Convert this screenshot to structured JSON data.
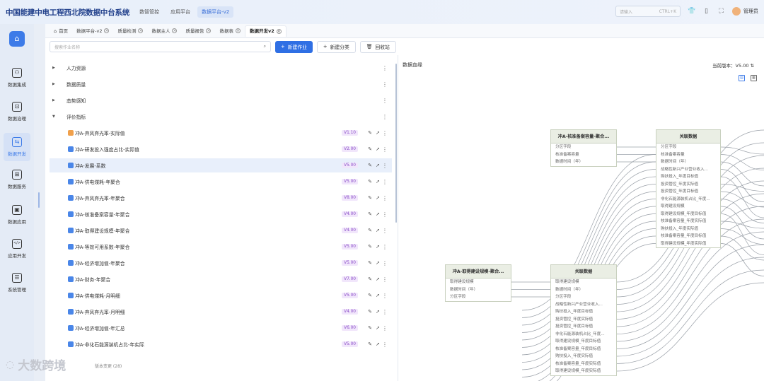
{
  "app": {
    "title": "中国能建中电工程西北院数据中台系统",
    "topnav": [
      {
        "label": "数智管控",
        "active": false
      },
      {
        "label": "应用平台",
        "active": false
      },
      {
        "label": "数据平台-v2",
        "active": true
      }
    ],
    "search_placeholder": "请输入",
    "search_shortcut": "CTRL+K",
    "user": "管理员"
  },
  "sidebar": {
    "items": [
      {
        "label": "数据集成",
        "icon": "integration-icon",
        "glyph": "⚇"
      },
      {
        "label": "数据治理",
        "icon": "folder-governance-icon",
        "glyph": "⊡"
      },
      {
        "label": "数据开发",
        "icon": "flow-develop-icon",
        "glyph": "⇆"
      },
      {
        "label": "数据服务",
        "icon": "grid-service-icon",
        "glyph": "⊞"
      },
      {
        "label": "数据应用",
        "icon": "app-icon",
        "glyph": "▣"
      },
      {
        "label": "应用开发",
        "icon": "code-icon",
        "glyph": "</>"
      },
      {
        "label": "系统管理",
        "icon": "settings-icon",
        "glyph": "☰"
      }
    ],
    "active": "数据开发"
  },
  "tabs": [
    {
      "label": "首页",
      "closable": false,
      "active": false
    },
    {
      "label": "数据平台-v2",
      "closable": true,
      "active": false
    },
    {
      "label": "质量检测",
      "closable": true,
      "active": false
    },
    {
      "label": "数据主人",
      "closable": true,
      "active": false
    },
    {
      "label": "质量报告",
      "closable": true,
      "active": false
    },
    {
      "label": "数据表",
      "closable": true,
      "active": false
    },
    {
      "label": "数据开发v2",
      "closable": true,
      "active": true
    }
  ],
  "toolbar": {
    "search_placeholder": "搜索作业名称",
    "new_job": "新建作业",
    "new_category": "新建分类",
    "recycle": "回收站"
  },
  "tree": {
    "folders": [
      "人力资源",
      "数据质量",
      "态势感知",
      "评价指标"
    ],
    "jobs": [
      {
        "name": "冲A-弃风弃光率-实际值",
        "version": "V1.10",
        "color": "#f0a04b"
      },
      {
        "name": "冲A-研发投入强度占比-实际值",
        "version": "V2.00",
        "color": "#4a86e8"
      },
      {
        "name": "冲A-发展-系数",
        "version": "V5.00",
        "color": "#4a86e8"
      },
      {
        "name": "冲A-供电煤耗-年聚合",
        "version": "V5.00",
        "color": "#4a86e8"
      },
      {
        "name": "冲A-弃风弃光率-年聚合",
        "version": "V8.00",
        "color": "#4a86e8"
      },
      {
        "name": "冲A-核准备案容量-年聚合",
        "version": "V4.00",
        "color": "#4a86e8"
      },
      {
        "name": "冲A-取得建设规模-年聚合",
        "version": "V4.00",
        "color": "#4a86e8"
      },
      {
        "name": "冲A-等效可用系数-年聚合",
        "version": "V5.00",
        "color": "#4a86e8"
      },
      {
        "name": "冲A-经济增加值-年聚合",
        "version": "V5.00",
        "color": "#4a86e8"
      },
      {
        "name": "冲A-财务-年聚合",
        "version": "V7.00",
        "color": "#4a86e8"
      },
      {
        "name": "冲A-供电煤耗-月明细",
        "version": "V5.00",
        "color": "#4a86e8"
      },
      {
        "name": "冲A-弃风弃光率-月明细",
        "version": "V4.00",
        "color": "#4a86e8"
      },
      {
        "name": "冲A-经济增加值-年汇总",
        "version": "V6.00",
        "color": "#4a86e8"
      },
      {
        "name": "冲A-非化石能源装机占比-年实际",
        "version": "V5.00",
        "color": "#4a86e8"
      }
    ],
    "selected_index": 2,
    "footer": "版本变更 (28)"
  },
  "lineage": {
    "title": "数据血缘",
    "current_version_label": "当前版本：V5.00",
    "nodes": [
      {
        "title": "冲A-核准备案容量-聚合...",
        "fields": [
          "分区字段",
          "核准备案容量",
          "数据时间（年）"
        ]
      },
      {
        "title": "关联数据",
        "fields": [
          "分区字段",
          "核准备案容量",
          "数据时间（年）",
          "战略性新兴产业营业收入...",
          "购扶投入_年度目标值",
          "投资管控_年度实际值",
          "投资管控_年度目标值",
          "非化石能源装机占比_年度...",
          "取得建设规模",
          "取得建设规模_年度目标值",
          "核准备案容量_年度实际值",
          "购扶投入_年度实际值",
          "核准备案容量_年度目标值",
          "取得建设规模_年度实际值"
        ]
      },
      {
        "title": "冲A-取得建设规模-聚合...",
        "fields": [
          "取得建设规模",
          "数据时间（年）",
          "分区字段"
        ]
      },
      {
        "title": "关联数据",
        "fields": [
          "取得建设规模",
          "数据时间（年）",
          "分区字段",
          "战略性新兴产业营业收入...",
          "购扶投入_年度目标值",
          "投资管控_年度实际值",
          "投资管控_年度目标值",
          "非化石能源装机占比_年度...",
          "取得建设规模_年度目标值",
          "核准备案容量_年度目标值",
          "购扶投入_年度实际值",
          "核准备案容量_年度实际值",
          "取得建设规模_年度实际值"
        ]
      }
    ]
  },
  "watermark": "大数跨境"
}
